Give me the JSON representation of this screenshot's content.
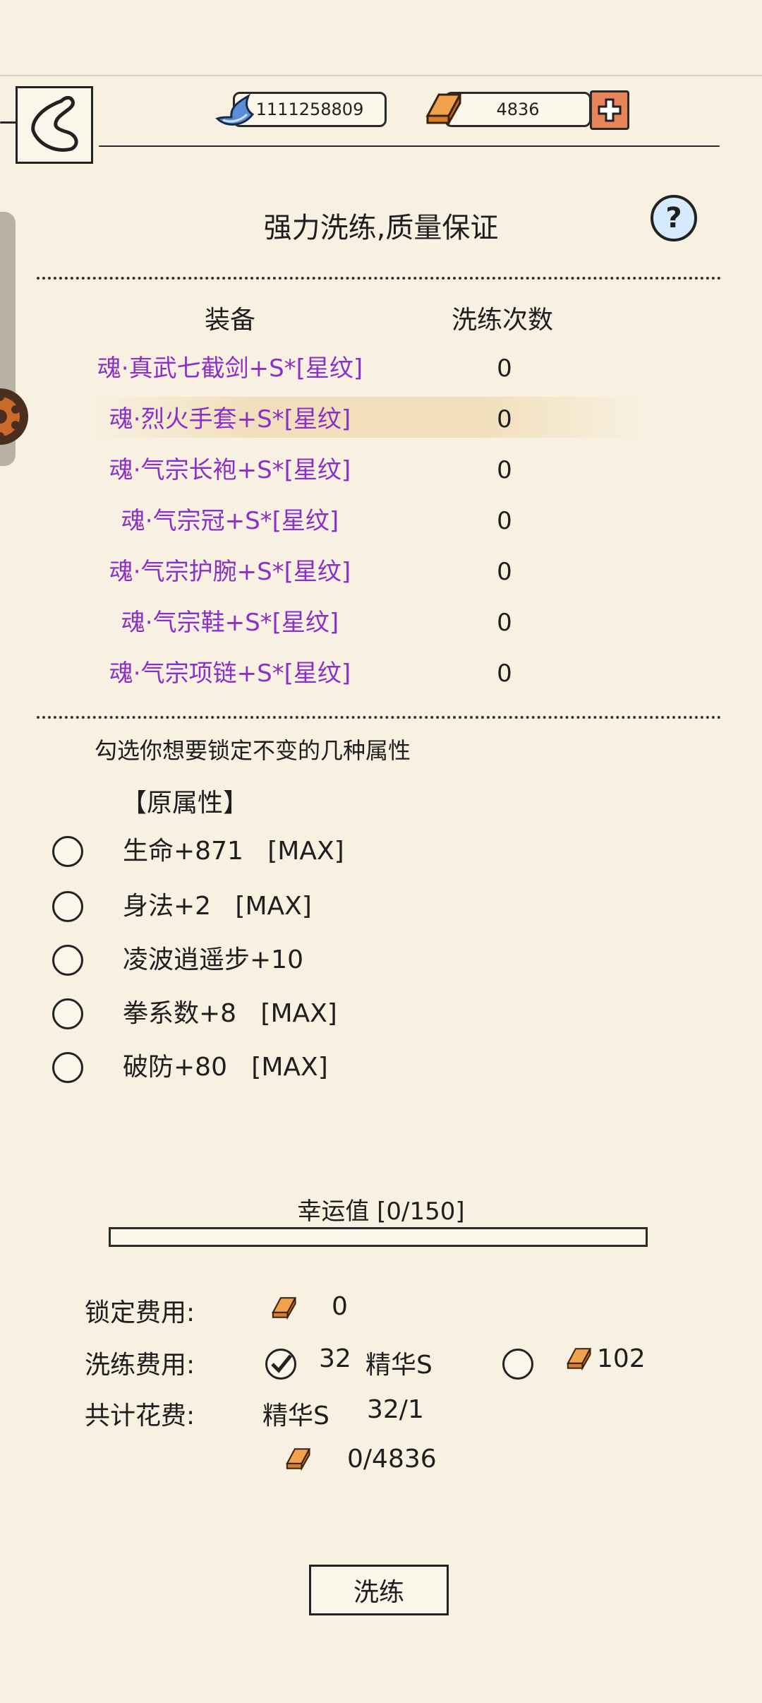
{
  "header": {
    "currency": {
      "icon": "gem-icon",
      "value": "1111258809"
    },
    "gold": {
      "icon": "gold-bar-icon",
      "value": "4836"
    }
  },
  "title": "强力洗练,质量保证",
  "table": {
    "headers": [
      "装备",
      "洗练次数"
    ],
    "rows": [
      {
        "name": "魂·真武七截剑+S*[星纹]",
        "count": "0"
      },
      {
        "name": "魂·烈火手套+S*[星纹]",
        "count": "0"
      },
      {
        "name": "魂·气宗长袍+S*[星纹]",
        "count": "0"
      },
      {
        "name": "魂·气宗冠+S*[星纹]",
        "count": "0"
      },
      {
        "name": "魂·气宗护腕+S*[星纹]",
        "count": "0"
      },
      {
        "name": "魂·气宗鞋+S*[星纹]",
        "count": "0"
      },
      {
        "name": "魂·气宗项链+S*[星纹]",
        "count": "0"
      }
    ]
  },
  "lock_hint": "勾选你想要锁定不变的几种属性",
  "attributes": {
    "section_label": "【原属性】",
    "items": [
      {
        "label": "生命+871   [MAX]",
        "checked": false
      },
      {
        "label": "身法+2   [MAX]",
        "checked": false
      },
      {
        "label": "凌波逍遥步+10",
        "checked": false
      },
      {
        "label": "拳系数+8   [MAX]",
        "checked": false
      },
      {
        "label": "破防+80   [MAX]",
        "checked": false
      }
    ]
  },
  "luck": {
    "label": "幸运值  [0/150]",
    "progress": 0
  },
  "costs": {
    "lock_label": "锁定费用:",
    "lock_value": "0",
    "refine_label": "洗练费用:",
    "refine_option1_value": "32",
    "refine_option1_unit": "精华S",
    "refine_option1_checked": true,
    "refine_option2_value": "102",
    "refine_option2_checked": false,
    "total_label": "共计花费:",
    "total_item_name": "精华S",
    "total_item_value": "32/1",
    "total_gold": "0/4836"
  },
  "action_button": "洗练",
  "colors": {
    "equipment_name": "#8b2fc9",
    "background": "#f8f1e2",
    "plus_button": "#e8845a"
  }
}
